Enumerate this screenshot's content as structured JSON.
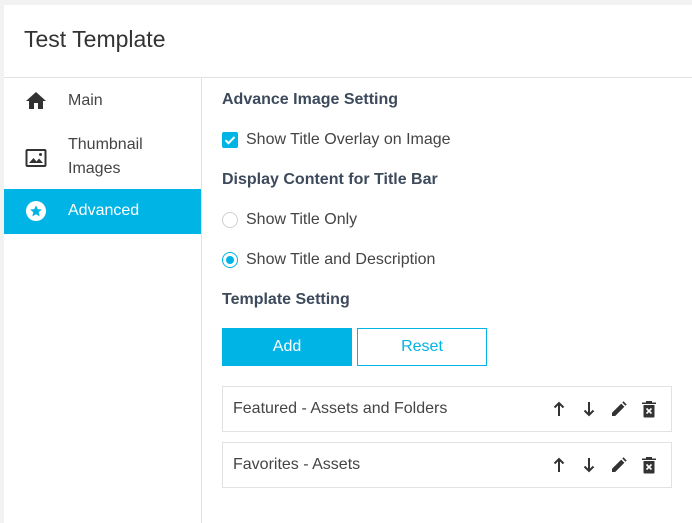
{
  "header": {
    "title": "Test Template"
  },
  "sidebar": {
    "items": [
      {
        "label": "Main",
        "icon": "home-icon"
      },
      {
        "label": "Thumbnail Images",
        "icon": "image-icon"
      },
      {
        "label": "Advanced",
        "icon": "star-icon",
        "active": true
      }
    ]
  },
  "main": {
    "image_section_title": "Advance Image Setting",
    "show_title_overlay": {
      "label": "Show Title Overlay on Image",
      "checked": true
    },
    "title_bar_section_title": "Display Content for Title Bar",
    "title_bar_options": [
      {
        "label": "Show Title Only",
        "selected": false
      },
      {
        "label": "Show Title and Description",
        "selected": true
      }
    ],
    "template_section_title": "Template Setting",
    "add_label": "Add",
    "reset_label": "Reset",
    "templates": [
      {
        "name": "Featured - Assets and Folders"
      },
      {
        "name": "Favorites - Assets"
      }
    ]
  },
  "colors": {
    "accent": "#00b4e5",
    "heading": "#3d4a5c",
    "text": "#444444",
    "border": "#e2e2e2"
  }
}
